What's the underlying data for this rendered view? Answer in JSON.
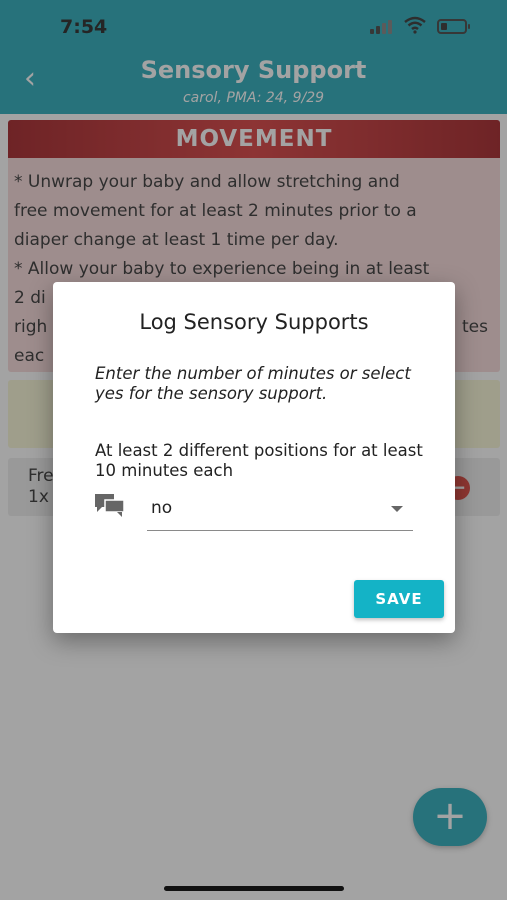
{
  "status_bar": {
    "time": "7:54",
    "battery_level": 0.25
  },
  "header": {
    "back_icon": "chevron-left-icon",
    "title": "Sensory Support",
    "subtitle": "carol, PMA: 24, 9/29",
    "color": "#16a3b3"
  },
  "movement_card": {
    "title": "MOVEMENT",
    "text_lines": [
      "* Unwrap your baby and allow stretching and",
      "free movement for at least 2 minutes prior to a",
      "diaper change at least 1 time per day.",
      "* Allow your baby to experience being in at least",
      "2 di",
      "righ",
      "eac"
    ],
    "text_line5_right": "tes",
    "header_color": "#c62828"
  },
  "item_card": {
    "line1": "Fre",
    "line2": "1x",
    "remove_icon": "minus-circle-icon"
  },
  "dialog": {
    "title": "Log Sensory Supports",
    "instructions": "Enter the number of minutes or select yes for the sensory support.",
    "support_label": "At least 2 different positions for at least 10 minutes each",
    "field_icon": "comment-icon",
    "selected_value": "no",
    "save_label": "SAVE",
    "accent": "#14b3c6"
  },
  "fab": {
    "icon": "plus-icon"
  }
}
